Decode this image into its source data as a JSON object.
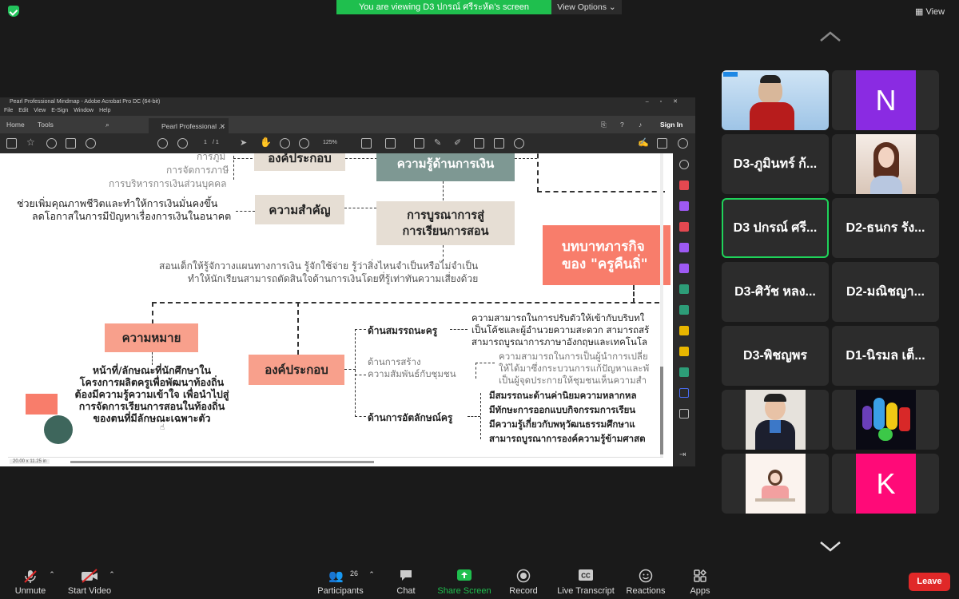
{
  "banner": {
    "text": "You are viewing D3 ปกรณ์ ศรีระหัด's screen",
    "view_options": "View Options",
    "view": "View"
  },
  "acrobat": {
    "title": "Pearl Professional Mindmap - Adobe Acrobat Pro DC (64-bit)",
    "menu": [
      "File",
      "Edit",
      "View",
      "E-Sign",
      "Window",
      "Help"
    ],
    "tabs": {
      "home": "Home",
      "tools": "Tools",
      "doc": "Pearl Professional ..."
    },
    "sign_in": "Sign In",
    "page_num": "1",
    "page_total": "/ 1",
    "zoom": "125%",
    "page_size": "20.00 x 11.25 in"
  },
  "mindmap": {
    "top_items": [
      "การภูมิ",
      "การจัดการภาษี",
      "การบริหารการเงินส่วนบุคคล"
    ],
    "box_components_top": "องค์ประกอบ",
    "box_finance": "ความรู้ด้านการเงิน",
    "importance_text_1": "ช่วยเพิ่มคุณภาพชีวิตและทำให้การเงินมั่นคงขึ้น",
    "importance_text_2": "ลดโอกาสในการมีปัญหาเรื่องการเงินในอนาคต",
    "box_importance": "ความสำคัญ",
    "box_integration_1": "การบูรณาการสู่",
    "box_integration_2": "การเรียนการสอน",
    "box_role_1": "บทบาทภารกิจ",
    "box_role_2": "ของ \"ครูคืนถิ่\"",
    "teach_text_1": "สอนเด็กให้รู้จักวางแผนทางการเงิน รู้จักใช้จ่าย รู้ว่าสิ่งไหนจำเป็นหรือไม่จำเป็น",
    "teach_text_2": "ทำให้นักเรียนสามารถตัดสินใจด้านการเงินโดยที่รู้เท่าทันความเสี่ยงด้วย",
    "box_meaning": "ความหมาย",
    "meaning_text": [
      "หน้าที่/ลักษณะที่นักศึกษาใน",
      "โครงการผลิตครูเพื่อพัฒนาท้องถิ่น",
      "ต้องมีความรู้ความเข้าใจ เพื่อนำไปสู่",
      "การจัดการเรียนการสอนในท้องถิ่น",
      "ของตนที่มีลักษณะเฉพาะตัว"
    ],
    "box_components": "องค์ประกอบ",
    "comp_competency": "ด้านสมรรถนะครู",
    "comp_competency_text": [
      "ความสามารถในการปรับตัวให้เข้ากับบริบทใ",
      "เป็นโค้ชและผู้อำนวยความสะดวก สามารถสร้",
      "สามารถบูรณาการภาษาอังกฤษและเทคโนโล"
    ],
    "comp_community_1": "ด้านการสร้าง",
    "comp_community_2": "ความสัมพันธ์กับชุมชน",
    "comp_community_text": [
      "ความสามารถในการเป็นผู้นำการเปลี่ย",
      "ให้ได้มาซึ่งกระบวนการแก้ปัญหาและพั",
      "เป็นผู้จุดประกายให้ชุมชนเห็นความสำ"
    ],
    "comp_identity": "ด้านการอัตลักษณ์ครู",
    "comp_identity_text": [
      "มีสมรรถนะด้านค่านิยมความหลากหล",
      "มีทักษะการออกแบบกิจกรรมการเรียน",
      "มีความรู้เกี่ยวกับพหุวัฒนธรรมศึกษาแ",
      "สามารถบูรณาการองค์ความรู้ข้ามศาสต"
    ]
  },
  "participants": [
    {
      "name": "",
      "kind": "video-host"
    },
    {
      "name": "N",
      "kind": "letter",
      "color": "#8a2be2"
    },
    {
      "name": "D3-ภูมินทร์ ก้...",
      "kind": "name"
    },
    {
      "name": "",
      "kind": "photo-girl"
    },
    {
      "name": "D3 ปกรณ์ ศรี...",
      "kind": "name",
      "active": true
    },
    {
      "name": "D2-ธนกร รัง...",
      "kind": "name"
    },
    {
      "name": "D3-ศิวัช หลง...",
      "kind": "name"
    },
    {
      "name": "D2-มณิชญา...",
      "kind": "name"
    },
    {
      "name": "D3-พิชญพร",
      "kind": "name"
    },
    {
      "name": "D1-นิรมล เต็...",
      "kind": "name"
    },
    {
      "name": "",
      "kind": "photo-grad"
    },
    {
      "name": "",
      "kind": "photo-movie"
    },
    {
      "name": "",
      "kind": "photo-cartoon"
    },
    {
      "name": "K",
      "kind": "letter",
      "color": "#ff0a78"
    }
  ],
  "toolbar": {
    "unmute": "Unmute",
    "start_video": "Start Video",
    "participants": "Participants",
    "participants_count": "26",
    "chat": "Chat",
    "share_screen": "Share Screen",
    "record": "Record",
    "live_transcript": "Live Transcript",
    "reactions": "Reactions",
    "apps": "Apps",
    "leave": "Leave"
  },
  "colors": {
    "accent_green": "#1fbf4e",
    "leave_red": "#e02828",
    "salmon": "#f8a08c",
    "coral": "#f87d6b",
    "beige": "#e6ded4",
    "teal": "#7e9893"
  }
}
